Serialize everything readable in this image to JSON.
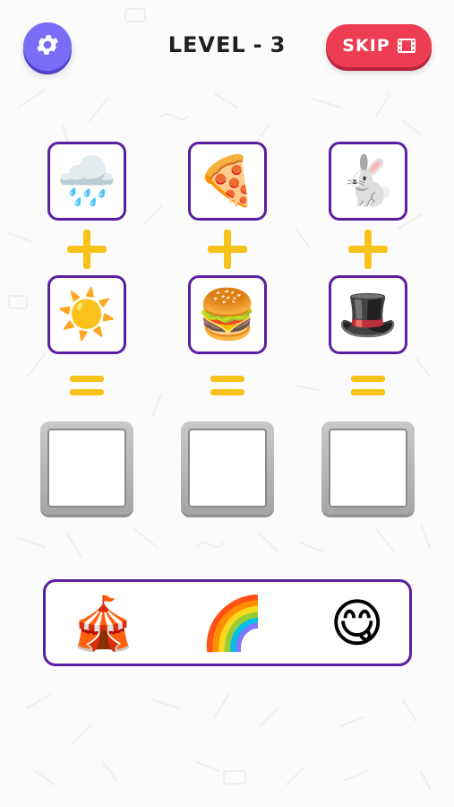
{
  "header": {
    "level_label": "LEVEL",
    "level_separator": "-",
    "level_number": "3",
    "skip_label": "SKIP",
    "settings_icon": "gear-icon",
    "skip_icon": "film-icon"
  },
  "puzzle": {
    "columns": [
      {
        "top": "🌧️",
        "bottom": "☀️",
        "top_name": "rain-cloud",
        "bottom_name": "sun"
      },
      {
        "top": "🍕",
        "bottom": "🍔",
        "top_name": "pizza",
        "bottom_name": "burger"
      },
      {
        "top": "🐇",
        "bottom": "🎩",
        "top_name": "rabbit",
        "bottom_name": "top-hat"
      }
    ],
    "operator_plus": "plus-icon",
    "operator_equals": "equals-icon"
  },
  "options": [
    {
      "emoji": "🎪",
      "name": "circus-tent"
    },
    {
      "emoji": "🌈",
      "name": "rainbow"
    },
    {
      "emoji": "😋",
      "name": "yummy-face"
    }
  ],
  "colors": {
    "settings_button": "#7b6cf6",
    "skip_button": "#ec3d54",
    "tile_border": "#5a1fa0",
    "operator": "#f7c21a"
  }
}
